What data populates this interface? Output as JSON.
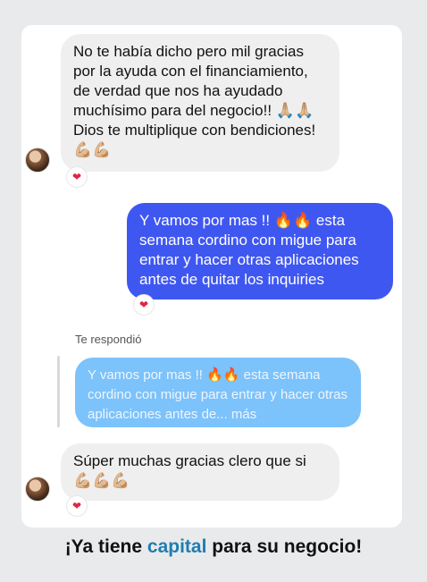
{
  "messages": {
    "first": "No te había dicho pero mil gracias por la ayuda con el financiamiento, de verdad que nos ha ayudado muchísimo para del negocio!! 🙏🏼🙏🏼 Dios te multiplique con bendiciones!💪🏼💪🏼",
    "sent": "Y vamos por mas !! 🔥🔥 esta semana cordino con migue para entrar y hacer otras aplicaciones antes de quitar los inquiries",
    "reply_label": "Te respondió",
    "quoted": "Y vamos por mas !! 🔥🔥 esta semana cordino con migue para entrar y hacer otras aplicaciones antes de... más",
    "last": "Súper muchas gracias clero que si 💪🏼💪🏼💪🏼"
  },
  "reaction": "❤",
  "banner": {
    "prefix": "¡Ya tiene ",
    "highlight": "capital",
    "suffix": " para su negocio!"
  },
  "colors": {
    "sent_bubble": "#3f57f1",
    "quoted_bubble": "#7cc2fb",
    "received_bubble": "#efefef",
    "accent": "#1f7db0"
  }
}
